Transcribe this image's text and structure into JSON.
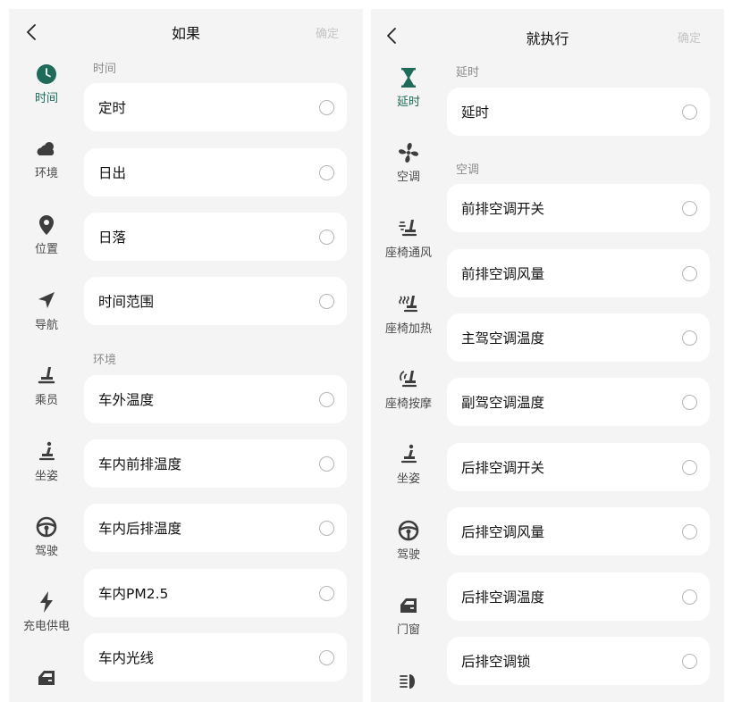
{
  "left": {
    "title": "如果",
    "confirm": "确定",
    "nav": [
      {
        "label": "时间",
        "icon": "clock-icon",
        "active": true
      },
      {
        "label": "环境",
        "icon": "weather-icon"
      },
      {
        "label": "位置",
        "icon": "location-pin-icon"
      },
      {
        "label": "导航",
        "icon": "navigation-arrow-icon"
      },
      {
        "label": "乘员",
        "icon": "seat-icon"
      },
      {
        "label": "坐姿",
        "icon": "seat-posture-icon"
      },
      {
        "label": "驾驶",
        "icon": "steering-wheel-icon"
      },
      {
        "label": "充电供电",
        "icon": "lightning-icon"
      },
      {
        "label": "",
        "icon": "car-door-icon"
      }
    ],
    "sections": [
      {
        "title": "时间",
        "items": [
          "定时",
          "日出",
          "日落",
          "时间范围"
        ]
      },
      {
        "title": "环境",
        "items": [
          "车外温度",
          "车内前排温度",
          "车内后排温度",
          "车内PM2.5",
          "车内光线"
        ]
      }
    ]
  },
  "right": {
    "title": "就执行",
    "confirm": "确定",
    "nav": [
      {
        "label": "延时",
        "icon": "hourglass-icon",
        "active": true
      },
      {
        "label": "空调",
        "icon": "fan-icon"
      },
      {
        "label": "座椅通风",
        "icon": "seat-ventilation-icon"
      },
      {
        "label": "座椅加热",
        "icon": "seat-heating-icon"
      },
      {
        "label": "座椅按摩",
        "icon": "seat-massage-icon"
      },
      {
        "label": "坐姿",
        "icon": "seat-posture-icon"
      },
      {
        "label": "驾驶",
        "icon": "steering-wheel-icon"
      },
      {
        "label": "门窗",
        "icon": "car-door-icon"
      },
      {
        "label": "",
        "icon": "headlight-icon"
      }
    ],
    "sections": [
      {
        "title": "延时",
        "items": [
          "延时"
        ]
      },
      {
        "title": "空调",
        "items": [
          "前排空调开关",
          "前排空调风量",
          "主驾空调温度",
          "副驾空调温度",
          "后排空调开关",
          "后排空调风量",
          "后排空调温度",
          "后排空调锁"
        ]
      }
    ]
  },
  "colors": {
    "accent": "#1e6b59",
    "icon": "#3d3d3d",
    "panel_bg": "#f4f4f4",
    "card_bg": "#ffffff",
    "muted": "#8c8c8c",
    "disabled": "#c4c4c4"
  }
}
